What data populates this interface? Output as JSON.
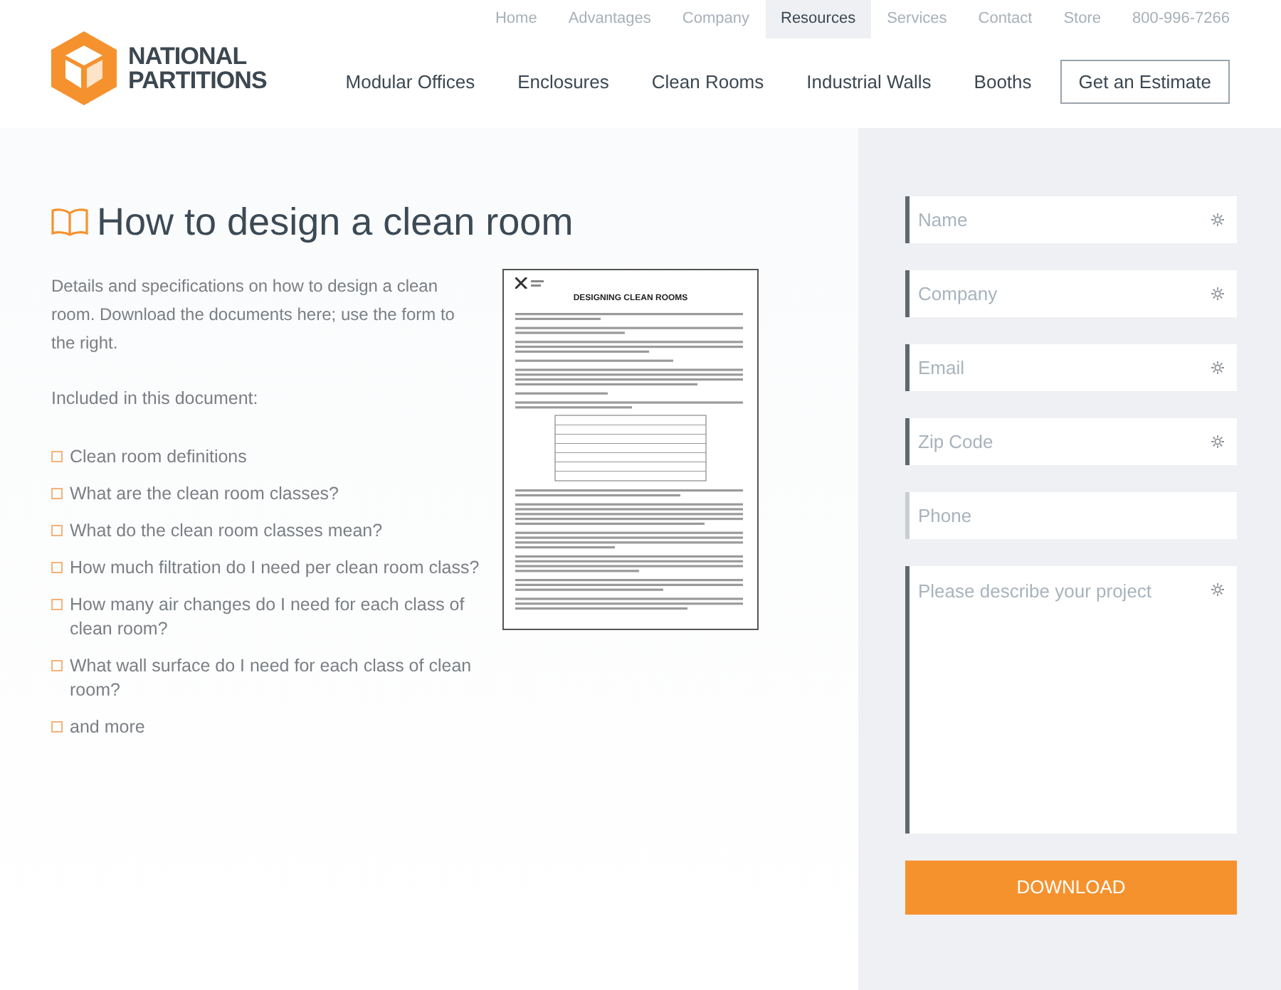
{
  "top_nav": [
    {
      "label": "Home",
      "selected": false
    },
    {
      "label": "Advantages",
      "selected": false
    },
    {
      "label": "Company",
      "selected": false
    },
    {
      "label": "Resources",
      "selected": true
    },
    {
      "label": "Services",
      "selected": false
    },
    {
      "label": "Contact",
      "selected": false
    },
    {
      "label": "Store",
      "selected": false
    }
  ],
  "phone": "800-996-7266",
  "logo": {
    "line_1": "NATIONAL",
    "line_2": "PARTITIONS"
  },
  "main_nav": [
    "Modular Offices",
    "Enclosures",
    "Clean Rooms",
    "Industrial Walls",
    "Booths"
  ],
  "estimate_button": "Get an Estimate",
  "heading": "How to design a clean room",
  "intro": "Details and specifications on how to design a clean room. Download the documents here; use the form to the right.",
  "included_label": "Included in this document:",
  "included_items": [
    "Clean room definitions",
    "What are the clean room classes?",
    "What do the clean room classes mean?",
    "How much filtration do I need per clean room class?",
    "How many air changes do I need for each class of clean room?",
    "What wall surface do I need for each class of clean room?",
    "and more"
  ],
  "document_preview": {
    "title": "DESIGNING CLEAN ROOMS"
  },
  "form_fields": [
    {
      "kind": "input",
      "placeholder": "Name",
      "required": true
    },
    {
      "kind": "input",
      "placeholder": "Company",
      "required": true
    },
    {
      "kind": "input",
      "placeholder": "Email",
      "required": true
    },
    {
      "kind": "input",
      "placeholder": "Zip Code",
      "required": true
    },
    {
      "kind": "input",
      "placeholder": "Phone",
      "required": false
    },
    {
      "kind": "textarea",
      "placeholder": "Please describe your project",
      "required": true
    }
  ],
  "download_button": "DOWNLOAD"
}
